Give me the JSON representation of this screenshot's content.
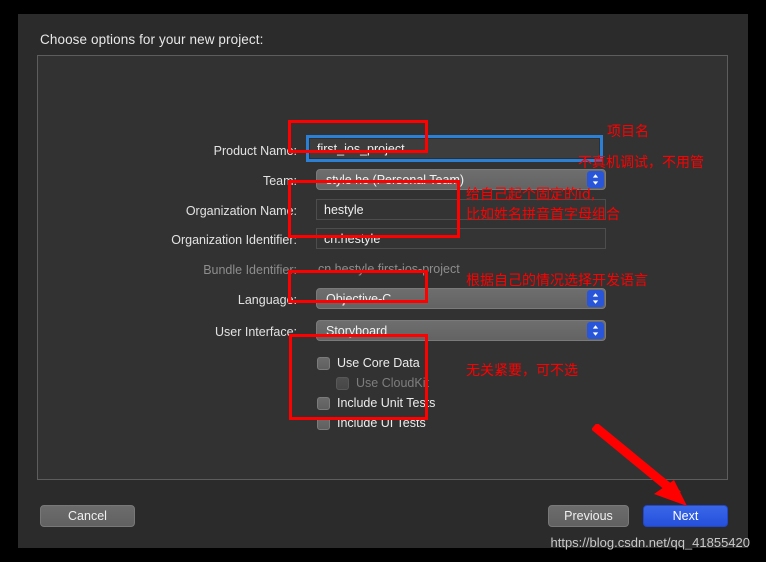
{
  "window": {
    "title": "Choose options for your new project:"
  },
  "form": {
    "rows": [
      {
        "label": "Product Name:",
        "value": "first_ios_project"
      },
      {
        "label": "Team:",
        "value": "style he (Personal Team)"
      },
      {
        "label": "Organization Name:",
        "value": "hestyle"
      },
      {
        "label": "Organization Identifier:",
        "value": "cn.hestyle"
      },
      {
        "label": "Bundle Identifier:",
        "value": "cn.hestyle.first-ios-project"
      },
      {
        "label": "Language:",
        "value": "Objective-C"
      },
      {
        "label": "User Interface:",
        "value": "Storyboard"
      }
    ],
    "checkboxes": [
      {
        "label": "Use Core Data",
        "checked": false,
        "disabled": false
      },
      {
        "label": "Use CloudKit",
        "checked": false,
        "disabled": true
      },
      {
        "label": "Include Unit Tests",
        "checked": false,
        "disabled": false
      },
      {
        "label": "Include UI Tests",
        "checked": false,
        "disabled": false
      }
    ]
  },
  "buttons": {
    "cancel": "Cancel",
    "previous": "Previous",
    "next": "Next"
  },
  "annotations": {
    "product_name": "项目名",
    "team": "不真机调试，不用管",
    "org_id_line1": "给自己起个固定的id,",
    "org_id_line2": "比如姓名拼音首字母组合",
    "language": "根据自己的情况选择开发语言",
    "checkboxes": "无关紧要，可不选"
  },
  "watermark": {
    "url": "https://blog.csdn.net/qq_41855420"
  },
  "colors": {
    "annotation_red": "#ff0000",
    "primary_button": "#2450dc",
    "focus_ring": "#2b7fd4",
    "stepper_blue": "#2956d8",
    "window_bg": "#2b2b2b",
    "panel_bg": "#323232"
  }
}
